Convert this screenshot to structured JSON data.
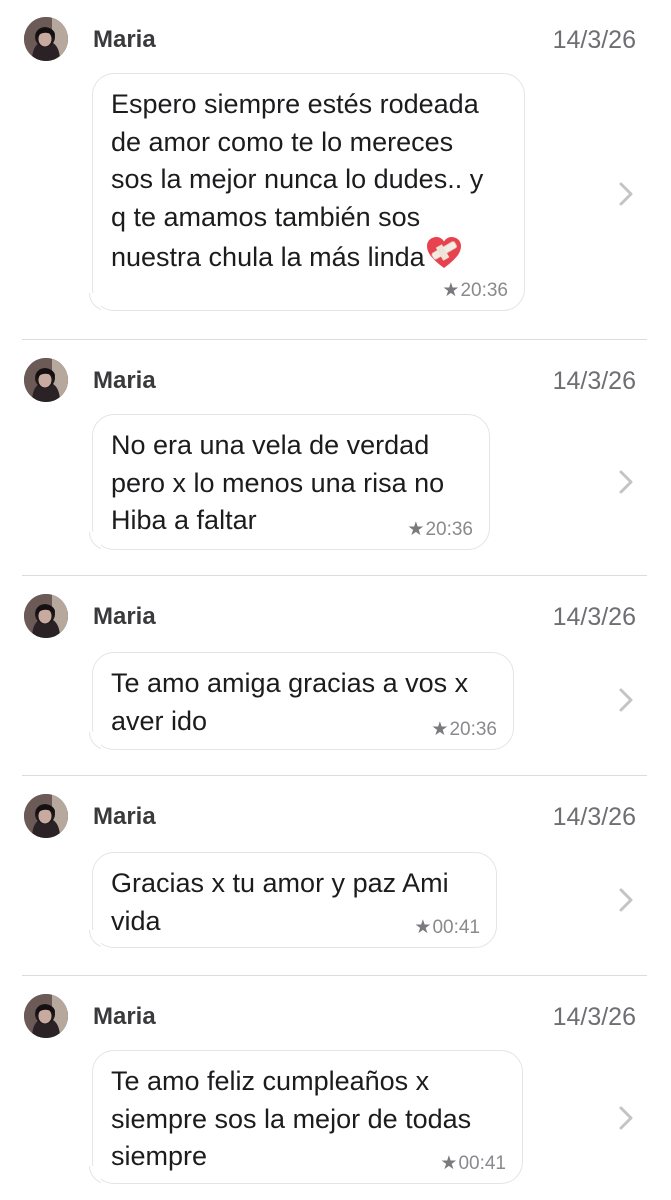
{
  "messages": [
    {
      "sender": "Maria",
      "date": "14/3/26",
      "text": "Espero siempre estés rodeada\nde amor como te lo mereces\nsos la mejor nunca lo dudes.. y\nq te amamos también sos\nnuestra chula la más linda",
      "emoji": "mending-heart-icon",
      "starred": true,
      "time": "20:36"
    },
    {
      "sender": "Maria",
      "date": "14/3/26",
      "text": "No era una vela de verdad\npero x lo menos una risa no\nHiba a faltar",
      "starred": true,
      "time": "20:36"
    },
    {
      "sender": "Maria",
      "date": "14/3/26",
      "text": "Te amo amiga gracias a vos x\naver ido",
      "starred": true,
      "time": "20:36"
    },
    {
      "sender": "Maria",
      "date": "14/3/26",
      "text": "Gracias x tu amor y paz Ami\nvida",
      "starred": true,
      "time": "00:41"
    },
    {
      "sender": "Maria",
      "date": "14/3/26",
      "text": "Te amo feliz cumpleaños x\nsiempre sos la mejor de todas\nsiempre",
      "starred": true,
      "time": "00:41"
    }
  ],
  "icons": {
    "star": "star-icon",
    "chevron": "chevron-right-icon",
    "avatar": "avatar"
  },
  "colors": {
    "chevron": "#c4c4c7",
    "divider": "#dcdcdf",
    "heart": "#e8424f"
  }
}
